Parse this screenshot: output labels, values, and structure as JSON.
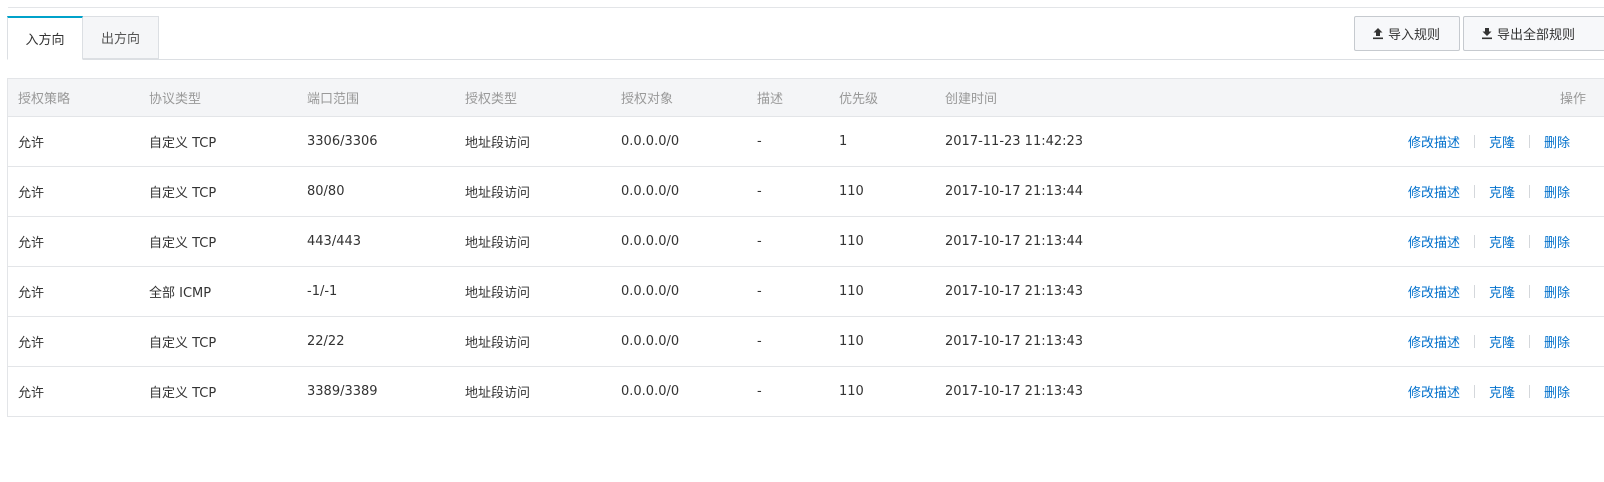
{
  "tabs": [
    {
      "label": "入方向"
    },
    {
      "label": "出方向"
    }
  ],
  "toolbar": {
    "import_label": "导入规则",
    "export_label": "导出全部规则"
  },
  "table": {
    "headers": [
      "授权策略",
      "协议类型",
      "端口范围",
      "授权类型",
      "授权对象",
      "描述",
      "优先级",
      "创建时间",
      "操作"
    ],
    "rows": [
      {
        "policy": "允许",
        "protocol": "自定义 TCP",
        "port": "3306/3306",
        "auth_type": "地址段访问",
        "auth_object": "0.0.0.0/0",
        "desc": "-",
        "priority": "1",
        "created": "2017-11-23 11:42:23"
      },
      {
        "policy": "允许",
        "protocol": "自定义 TCP",
        "port": "80/80",
        "auth_type": "地址段访问",
        "auth_object": "0.0.0.0/0",
        "desc": "-",
        "priority": "110",
        "created": "2017-10-17 21:13:44"
      },
      {
        "policy": "允许",
        "protocol": "自定义 TCP",
        "port": "443/443",
        "auth_type": "地址段访问",
        "auth_object": "0.0.0.0/0",
        "desc": "-",
        "priority": "110",
        "created": "2017-10-17 21:13:44"
      },
      {
        "policy": "允许",
        "protocol": "全部 ICMP",
        "port": "-1/-1",
        "auth_type": "地址段访问",
        "auth_object": "0.0.0.0/0",
        "desc": "-",
        "priority": "110",
        "created": "2017-10-17 21:13:43"
      },
      {
        "policy": "允许",
        "protocol": "自定义 TCP",
        "port": "22/22",
        "auth_type": "地址段访问",
        "auth_object": "0.0.0.0/0",
        "desc": "-",
        "priority": "110",
        "created": "2017-10-17 21:13:43"
      },
      {
        "policy": "允许",
        "protocol": "自定义 TCP",
        "port": "3389/3389",
        "auth_type": "地址段访问",
        "auth_object": "0.0.0.0/0",
        "desc": "-",
        "priority": "110",
        "created": "2017-10-17 21:13:43"
      }
    ],
    "actions": {
      "edit_desc": "修改描述",
      "clone": "克隆",
      "delete": "删除"
    }
  },
  "colors": {
    "link": "#0070cc",
    "active_tab_accent": "#00a2ca",
    "header_bg": "#f4f5f7",
    "header_text": "#999999"
  },
  "icons": {
    "import": "upload-icon",
    "export": "download-icon"
  }
}
